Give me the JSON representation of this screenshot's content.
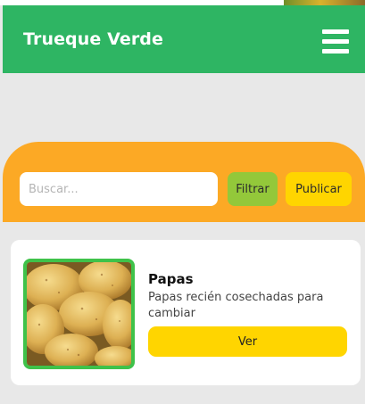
{
  "header": {
    "brand": "Trueque Verde",
    "menu_icon": "hamburger-menu-icon",
    "background_color": "#2eb563"
  },
  "search": {
    "placeholder": "Buscar...",
    "value": "",
    "filter_label": "Filtrar",
    "publish_label": "Publicar",
    "bar_color": "#fca925"
  },
  "listings": [
    {
      "title": "Papas",
      "description": "Papas recién cosechadas para cambiar",
      "button_label": "Ver",
      "image_icon": "potatoes-photo"
    }
  ],
  "colors": {
    "accent_yellow": "#ffd500",
    "filter_green": "#93c83a",
    "thumb_border": "#3fc24a"
  }
}
